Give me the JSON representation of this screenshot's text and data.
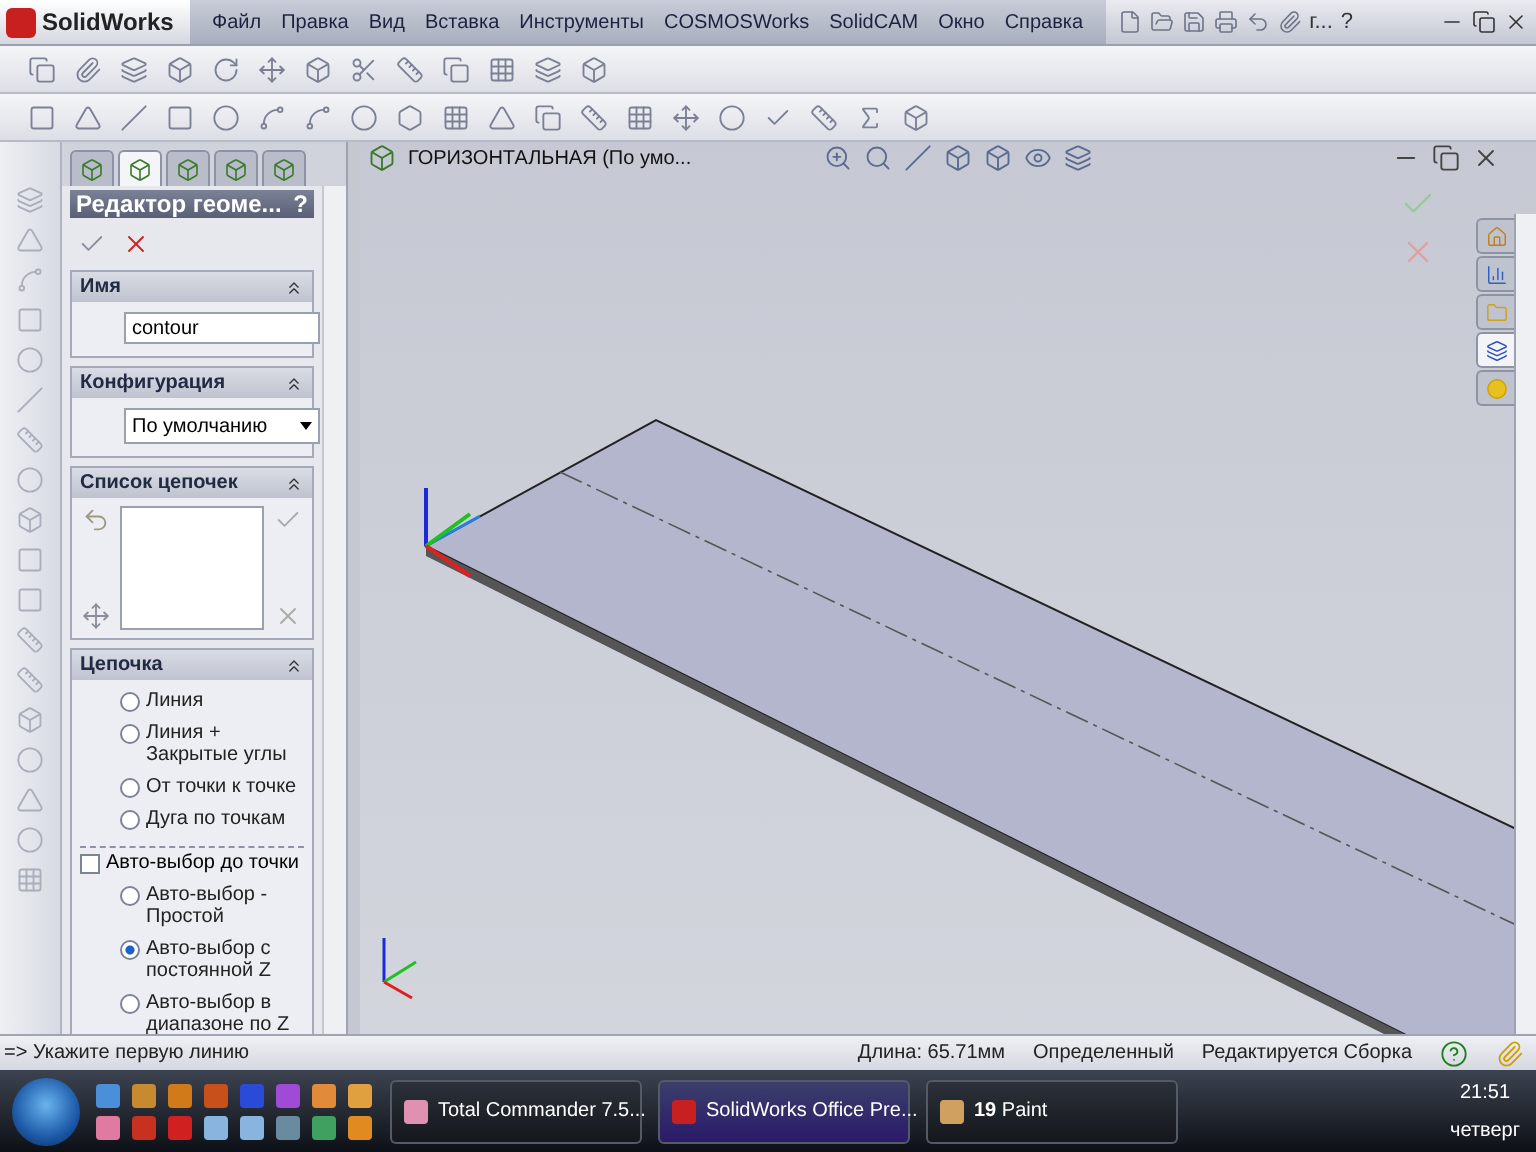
{
  "app": {
    "logo": "SolidWorks",
    "menu": [
      "Файл",
      "Правка",
      "Вид",
      "Вставка",
      "Инструменты",
      "COSMOSWorks",
      "SolidCAM",
      "Окно",
      "Справка"
    ],
    "toolbar_label": "г...",
    "help": "?"
  },
  "document": {
    "tree_item": "ГОРИЗОНТАЛЬНАЯ  (По умо..."
  },
  "panel_tabs": [
    {
      "selected": false
    },
    {
      "selected": true
    },
    {
      "selected": false
    },
    {
      "selected": false
    },
    {
      "selected": false
    }
  ],
  "property_manager": {
    "title": "Редактор геоме...",
    "help": "?",
    "name_section": {
      "title": "Имя",
      "value": "contour"
    },
    "config_section": {
      "title": "Конфигурация",
      "value": "По умолчанию"
    },
    "chains_section": {
      "title": "Список цепочек"
    },
    "chain_section": {
      "title": "Цепочка",
      "options": [
        {
          "label": "Линия",
          "selected": false
        },
        {
          "label": "Линия + Закрытые углы",
          "selected": false
        },
        {
          "label": "От точки к точке",
          "selected": false
        },
        {
          "label": "Дуга по точкам",
          "selected": false
        }
      ],
      "auto_select": {
        "label": "Авто-выбор до точки",
        "checked": false
      },
      "auto_options": [
        {
          "label": "Авто-выбор - Простой",
          "selected": false
        },
        {
          "label": "Авто-выбор с постоянной Z",
          "selected": true
        },
        {
          "label": "Авто-выбор в диапазоне по Z",
          "selected": false
        }
      ]
    }
  },
  "task_pane_tabs": [
    {
      "selected": false
    },
    {
      "selected": false
    },
    {
      "selected": false
    },
    {
      "selected": true
    },
    {
      "selected": false
    }
  ],
  "status_bar": {
    "prompt": "=> Укажите первую линию",
    "length": "Длина: 65.71мм",
    "state": "Определенный",
    "mode": "Редактируется Сборка"
  },
  "taskbar": {
    "windows": [
      {
        "label": "Total Commander 7.5...",
        "selected": false
      },
      {
        "label": "SolidWorks Office Pre...",
        "selected": true
      },
      {
        "label": "**19** Paint",
        "selected": false
      }
    ],
    "time": "21:51",
    "day": "четверг"
  }
}
